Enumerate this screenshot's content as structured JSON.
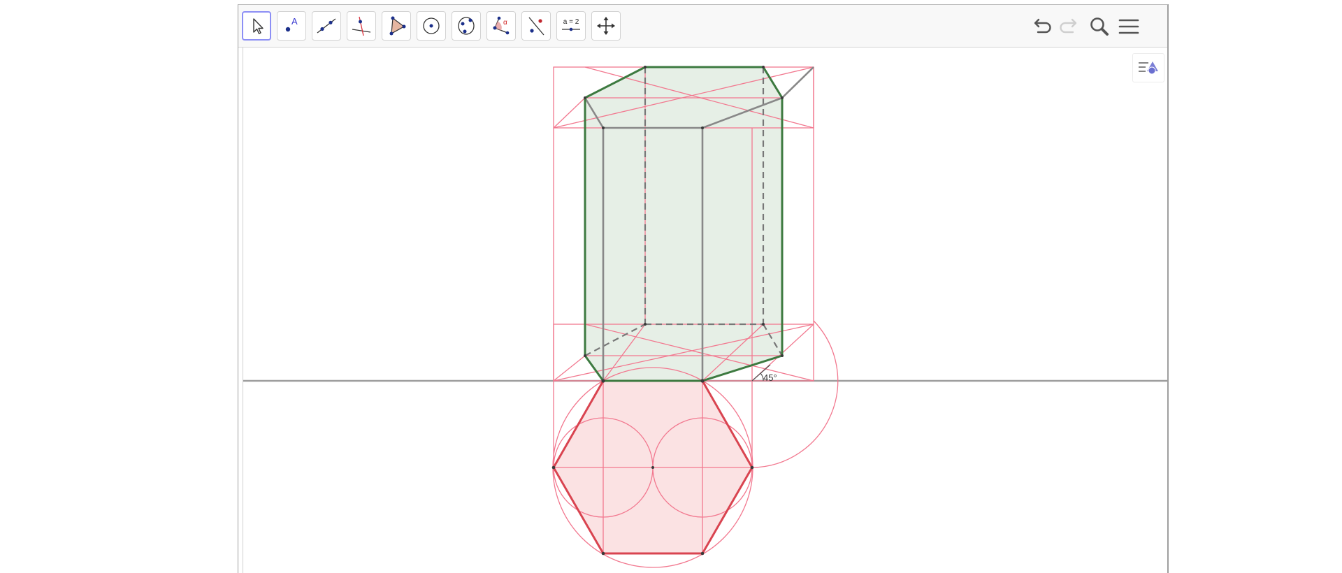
{
  "toolbar": {
    "tools": [
      {
        "id": "move",
        "icon": "cursor-arrow-icon",
        "active": true
      },
      {
        "id": "point",
        "icon": "point-icon",
        "label": "A"
      },
      {
        "id": "line",
        "icon": "line-through-points-icon"
      },
      {
        "id": "perpendicular",
        "icon": "perpendicular-line-icon"
      },
      {
        "id": "polygon",
        "icon": "polygon-icon"
      },
      {
        "id": "circle",
        "icon": "circle-center-point-icon"
      },
      {
        "id": "conic",
        "icon": "circle-through-points-icon"
      },
      {
        "id": "angle",
        "icon": "angle-icon",
        "label": "α"
      },
      {
        "id": "reflect",
        "icon": "reflect-line-icon"
      },
      {
        "id": "slider",
        "icon": "slider-icon",
        "label": "a = 2"
      },
      {
        "id": "move-view",
        "icon": "move-graphics-view-icon"
      }
    ],
    "right": [
      "undo-icon",
      "redo-icon",
      "search-icon",
      "menu-icon"
    ]
  },
  "canvas": {
    "angle_label": "45°",
    "colors": {
      "construction": "#f2788f",
      "outline": "#3d7a40",
      "hidden": "#777777",
      "hexagon": "#d94450",
      "prism_fill": "#e6efe6",
      "hex_fill": "#fbe2e3",
      "axis": "#9e9e9e"
    }
  }
}
